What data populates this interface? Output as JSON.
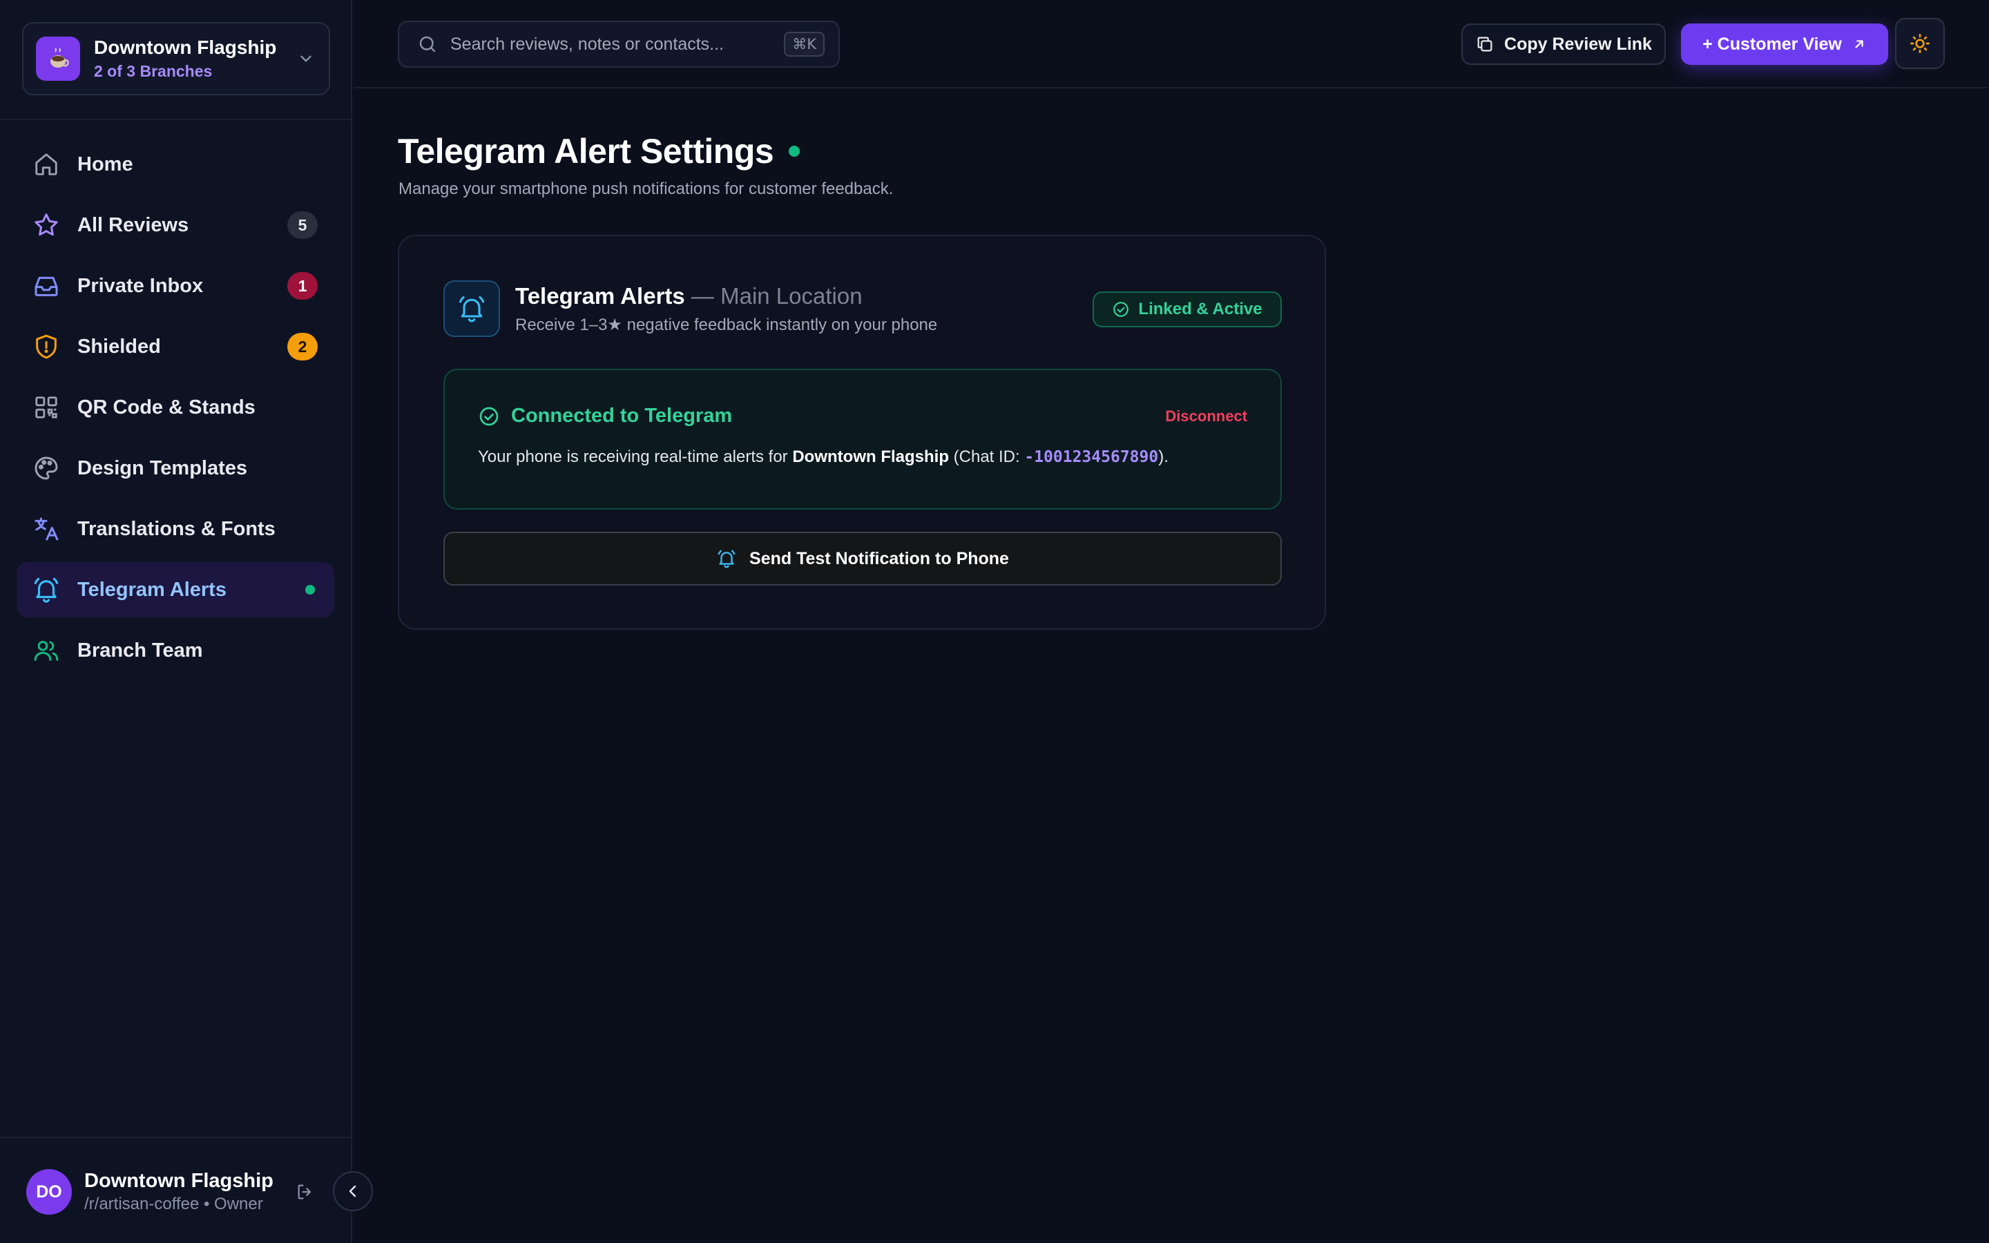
{
  "branch": {
    "name": "Downtown Flagship",
    "count_label": "2 of 3 Branches"
  },
  "sidebar": {
    "items": [
      {
        "label": "Home",
        "icon": "home-icon",
        "badge": ""
      },
      {
        "label": "All Reviews",
        "icon": "star-icon",
        "badge": "5"
      },
      {
        "label": "Private Inbox",
        "icon": "inbox-icon",
        "badge": "1"
      },
      {
        "label": "Shielded",
        "icon": "shield-icon",
        "badge": "2"
      },
      {
        "label": "QR Code & Stands",
        "icon": "qr-code-icon",
        "badge": ""
      },
      {
        "label": "Design Templates",
        "icon": "palette-icon",
        "badge": ""
      },
      {
        "label": "Translations & Fonts",
        "icon": "translate-icon",
        "badge": ""
      },
      {
        "label": "Telegram Alerts",
        "icon": "bell-ring-icon",
        "badge": "",
        "active": true
      },
      {
        "label": "Branch Team",
        "icon": "users-icon",
        "badge": ""
      }
    ]
  },
  "user": {
    "initials": "DO",
    "name": "Downtown Flagship",
    "sub": "/r/artisan-coffee • Owner"
  },
  "topbar": {
    "search_placeholder": "Search reviews, notes or contacts...",
    "search_shortcut": "⌘K",
    "copy_label": "Copy Review Link",
    "customer_label": "+ Customer View"
  },
  "page": {
    "title": "Telegram Alert Settings",
    "subtitle": "Manage your smartphone push notifications for customer feedback."
  },
  "card": {
    "title": "Telegram Alerts",
    "title_sep": " — ",
    "location": "Main Location",
    "description": "Receive 1–3★ negative feedback instantly on your phone",
    "status": "Linked & Active",
    "connected_title": "Connected to Telegram",
    "disconnect_label": "Disconnect",
    "text_prefix": "Your phone is receiving real-time alerts for ",
    "text_branch": "Downtown Flagship",
    "text_chat_prefix": " (Chat ID: ",
    "chat_id": "-1001234567890",
    "text_suffix": ").",
    "test_button": "Send Test Notification to Phone"
  },
  "colors": {
    "accent": "#6d3cf0",
    "success": "#10b981",
    "danger": "#f43f5e",
    "warning": "#f59e0b",
    "background": "#0b0f1c"
  }
}
